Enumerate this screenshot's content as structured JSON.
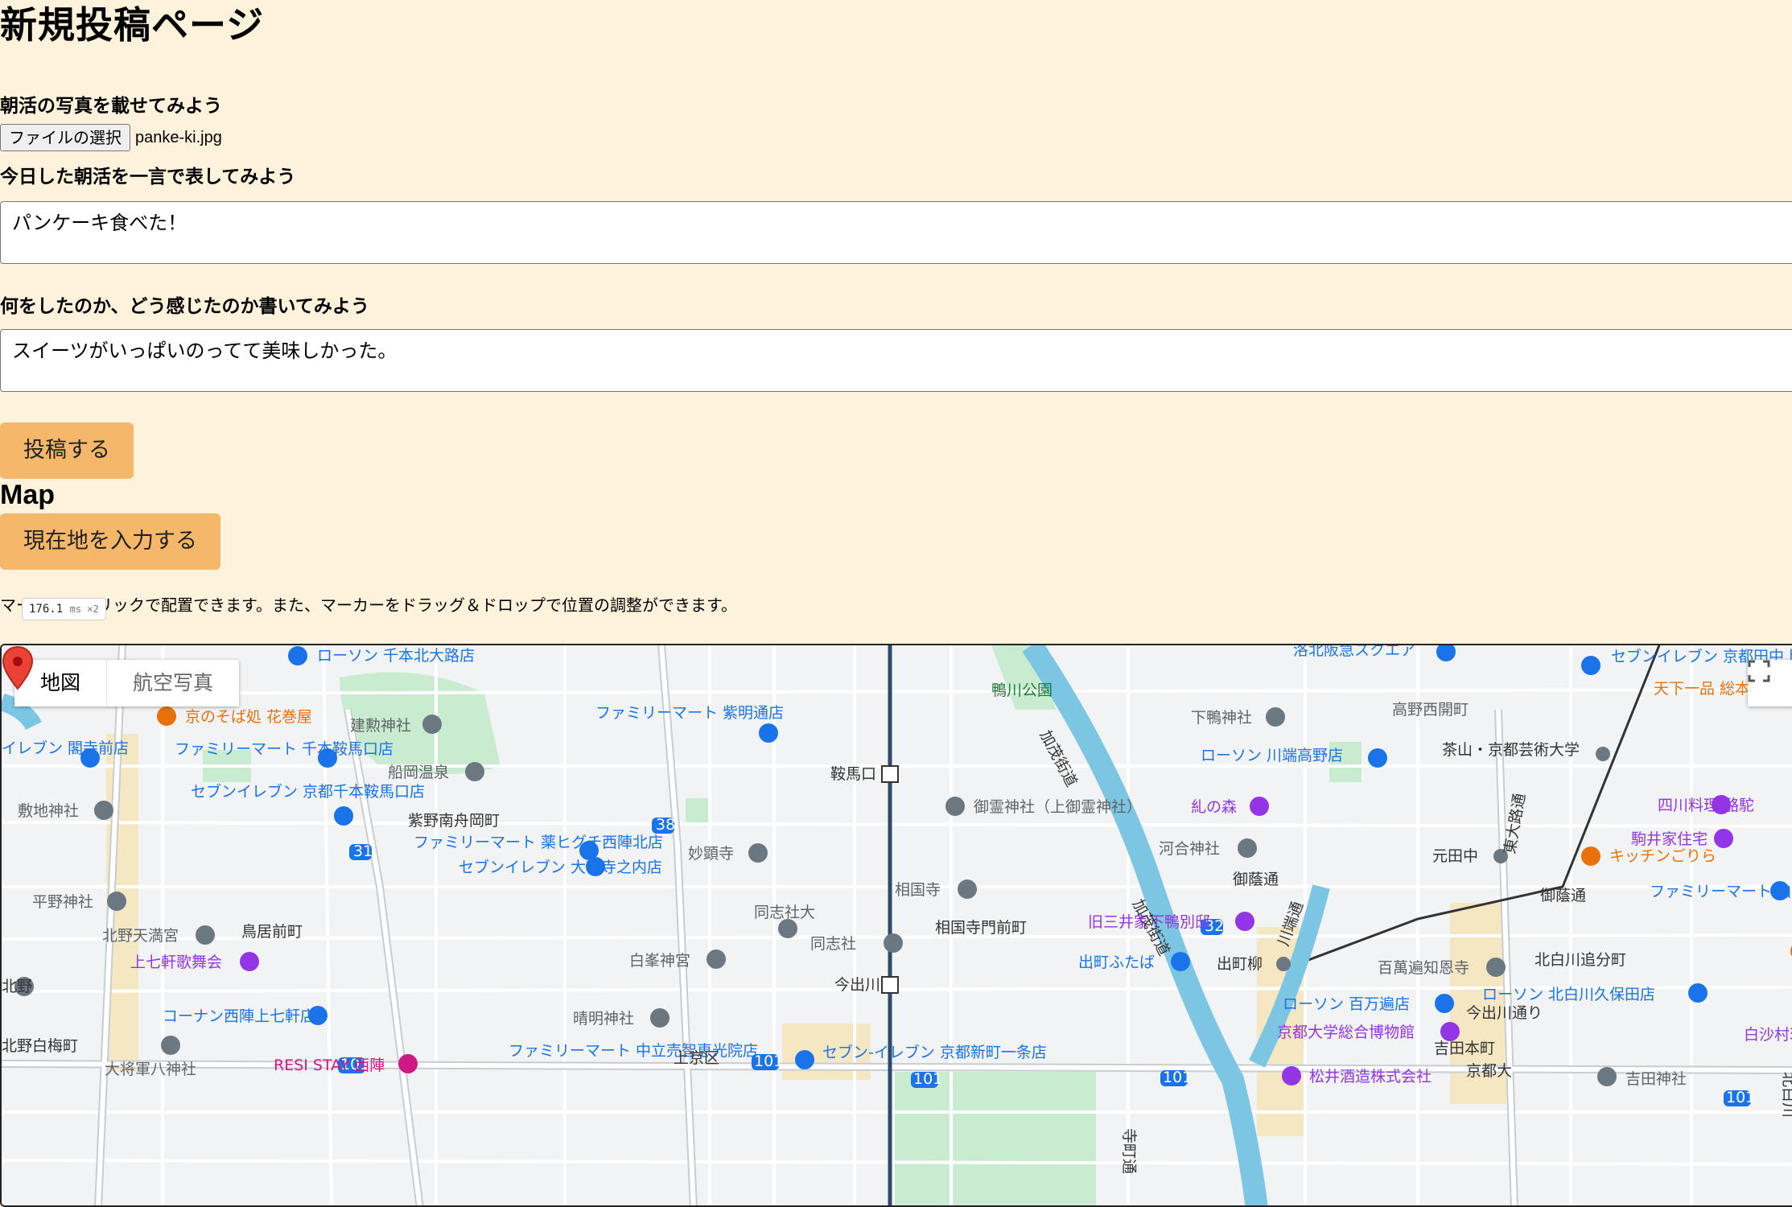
{
  "page": {
    "title": "新規投稿ページ"
  },
  "form": {
    "photo_label": "朝活の写真を載せてみよう",
    "file_button": "ファイルの選択",
    "file_name": "panke-ki.jpg",
    "title_label": "今日した朝活を一言で表してみよう",
    "title_value": "パンケーキ食べた！",
    "body_label": "何をしたのか、どう感じたのか書いてみよう",
    "body_value": "スイーツがいっぱいのってて美味しかった。",
    "submit_label": "投稿する"
  },
  "map_section": {
    "heading": "Map",
    "locate_button": "現在地を入力する",
    "hint": "マーカーはクリックで配置できます。また、マーカーをドラッグ＆ドロップで位置の調整ができます。",
    "perf_value": "176.1",
    "perf_unit": "ms ×2",
    "map_type_options": [
      "地図",
      "航空写真"
    ],
    "selected_map_type": "地図",
    "fullscreen_icon": "fullscreen-icon",
    "marker_icon": "map-pin-icon"
  },
  "map_labels": {
    "l1": "ローソン 千本北大路店",
    "l2": "京のそば処 花巻屋",
    "l3": "建勲神社",
    "l4": "ファミリーマート 紫明通店",
    "l5": "鴨川公園",
    "l6": "洛北阪急スクエア",
    "l7": "セブンイレブン 京都田中上古川町店",
    "l8": "天下一品 総本店",
    "l9": "下鴨神社",
    "l10": "高野西開町",
    "l11": "ファミリーマート 千本鞍馬口店",
    "l12": "イレブン 閣寺前店",
    "l13": "ローソン 川端高野店",
    "l14": "茶山・京都芸術大学",
    "l15": "船岡温泉",
    "l16": "鞍馬口",
    "l17": "敷地神社",
    "l18": "セブンイレブン 京都千本鞍馬口店",
    "l19": "御霊神社（上御霊神社）",
    "l20": "糺の森",
    "l21": "四川料理 駱駝",
    "l22": "紫野南舟岡町",
    "l23": "ファミリーマート 薬ヒグチ西陣北店",
    "l24": "駒井家住宅",
    "l25": "河合神社",
    "l26": "妙顕寺",
    "l27": "元田中",
    "l28": "キッチンごりら",
    "l29": "セブンイレブン 大宮寺之内店",
    "l30": "御蔭通",
    "l31": "相国寺",
    "l32": "平野神社",
    "l33": "ファミリーマート 白川通別当町店",
    "l34": "同志社大",
    "l35": "旧三井家下鴨別邸",
    "l36": "北野天満宮",
    "l37": "鳥居前町",
    "l38": "相国寺門前町",
    "l39": "同志社",
    "l40": "上七軒歌舞会",
    "l41": "白峯神宮",
    "l42": "出町ふたば",
    "l43": "出町柳",
    "l44": "百萬遍知恩寺",
    "l45": "北白川追分町",
    "l46": "今出川",
    "l47": "コーナン西陣上七軒店",
    "l48": "晴明神社",
    "l49": "ローソン 百万遍店",
    "l50": "ローソン 北白川久保田店",
    "l51": "今出川通り",
    "l52": "京都大学総合博物館",
    "l53": "白沙村荘 関雪記",
    "l54": "北野白梅町",
    "l55": "ファミリーマート 中立売智恵光院店",
    "l56": "上京区",
    "l57": "セブン-イレブン 京都新町一条店",
    "l58": "大将軍八神社",
    "l59": "RESI STAY 西陣",
    "l60": "吉田本町",
    "l61": "京都大",
    "l62": "松井酒造株式会社",
    "l63": "吉田神社",
    "l64": "加茂街道",
    "l65": "川端通",
    "l66": "東大路通",
    "l67": "御蔭通",
    "l68": "寺町通",
    "l69": "北白川",
    "l70": "北野",
    "road_101": "101",
    "road_38": "38",
    "road_31": "31",
    "road_32": "32"
  },
  "colors": {
    "background": "#fff2db",
    "button": "#f5b76a",
    "park": "#c9ebcf",
    "river": "#7cc6e3",
    "poi_blue": "#1a73e8",
    "poi_gray": "#6b7781",
    "poi_orange": "#e8710a",
    "poi_purple": "#9334e6",
    "poi_pink": "#d01884",
    "marker": "#ea4335"
  }
}
